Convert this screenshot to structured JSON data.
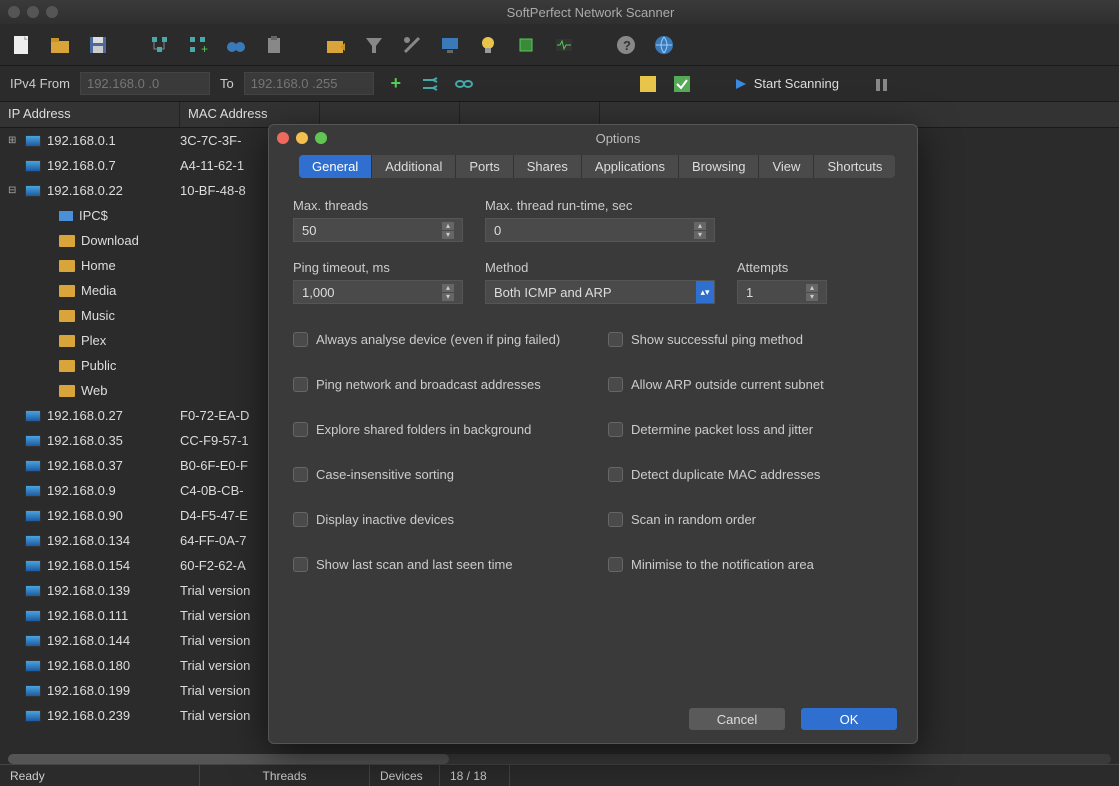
{
  "app_title": "SoftPerfect Network Scanner",
  "range": {
    "from_label": "IPv4 From",
    "from_placeholder": "192.168.0 .0",
    "to_label": "To",
    "to_placeholder": "192.168.0 .255"
  },
  "start_label": "Start Scanning",
  "columns": {
    "ip": "IP Address",
    "mac": "MAC Address",
    "rt": "",
    "hn": ""
  },
  "rows": [
    {
      "twisty": "+",
      "icon": "mon",
      "ip": "192.168.0.1",
      "mac": "3C-7C-3F-"
    },
    {
      "twisty": "",
      "icon": "mon",
      "ip": "192.168.0.7",
      "mac": "A4-11-62-1"
    },
    {
      "twisty": "-",
      "icon": "mon",
      "ip": "192.168.0.22",
      "mac": "10-BF-48-8"
    },
    {
      "twisty": "",
      "indent": 2,
      "icon": "share",
      "ip": "IPC$",
      "mac": ""
    },
    {
      "twisty": "",
      "indent": 2,
      "icon": "fold",
      "ip": "Download",
      "mac": ""
    },
    {
      "twisty": "",
      "indent": 2,
      "icon": "fold",
      "ip": "Home",
      "mac": ""
    },
    {
      "twisty": "",
      "indent": 2,
      "icon": "fold",
      "ip": "Media",
      "mac": ""
    },
    {
      "twisty": "",
      "indent": 2,
      "icon": "fold",
      "ip": "Music",
      "mac": ""
    },
    {
      "twisty": "",
      "indent": 2,
      "icon": "fold",
      "ip": "Plex",
      "mac": ""
    },
    {
      "twisty": "",
      "indent": 2,
      "icon": "fold",
      "ip": "Public",
      "mac": ""
    },
    {
      "twisty": "",
      "indent": 2,
      "icon": "fold",
      "ip": "Web",
      "mac": ""
    },
    {
      "twisty": "",
      "icon": "mon",
      "ip": "192.168.0.27",
      "mac": "F0-72-EA-D"
    },
    {
      "twisty": "",
      "icon": "mon",
      "ip": "192.168.0.35",
      "mac": "CC-F9-57-1"
    },
    {
      "twisty": "",
      "icon": "mon",
      "ip": "192.168.0.37",
      "mac": "B0-6F-E0-F"
    },
    {
      "twisty": "",
      "icon": "mon",
      "ip": "192.168.0.9",
      "mac": "C4-0B-CB-"
    },
    {
      "twisty": "",
      "icon": "mon",
      "ip": "192.168.0.90",
      "mac": "D4-F5-47-E"
    },
    {
      "twisty": "",
      "icon": "mon",
      "ip": "192.168.0.134",
      "mac": "64-FF-0A-7"
    },
    {
      "twisty": "",
      "icon": "mon",
      "ip": "192.168.0.154",
      "mac": "60-F2-62-A"
    },
    {
      "twisty": "",
      "icon": "mon",
      "ip": "192.168.0.139",
      "mac": "Trial version"
    },
    {
      "twisty": "",
      "icon": "mon",
      "ip": "192.168.0.111",
      "mac": "Trial version"
    },
    {
      "twisty": "",
      "icon": "mon",
      "ip": "192.168.0.144",
      "mac": "Trial version"
    },
    {
      "twisty": "",
      "icon": "mon",
      "ip": "192.168.0.180",
      "mac": "Trial version"
    },
    {
      "twisty": "",
      "icon": "mon",
      "ip": "192.168.0.199",
      "mac": "Trial version"
    },
    {
      "twisty": "",
      "icon": "mon",
      "ip": "192.168.0.239",
      "mac": "Trial version"
    }
  ],
  "status": {
    "ready": "Ready",
    "threads": "Threads",
    "devices": "Devices",
    "count": "18 / 18"
  },
  "dialog": {
    "title": "Options",
    "tabs": [
      "General",
      "Additional",
      "Ports",
      "Shares",
      "Applications",
      "Browsing",
      "View",
      "Shortcuts"
    ],
    "active_tab": 0,
    "fields": {
      "max_threads": {
        "label": "Max. threads",
        "value": "50"
      },
      "max_runtime": {
        "label": "Max. thread run-time, sec",
        "value": "0"
      },
      "ping_timeout": {
        "label": "Ping timeout, ms",
        "value": "1,000"
      },
      "method": {
        "label": "Method",
        "value": "Both ICMP and ARP"
      },
      "attempts": {
        "label": "Attempts",
        "value": "1"
      }
    },
    "checkboxes": [
      [
        "Always analyse device (even if ping failed)",
        "Show successful ping method"
      ],
      [
        "Ping network and broadcast addresses",
        "Allow ARP outside current subnet"
      ],
      [
        "Explore shared folders in background",
        "Determine packet loss and jitter"
      ],
      [
        "Case-insensitive sorting",
        "Detect duplicate MAC addresses"
      ],
      [
        "Display inactive devices",
        "Scan in random order"
      ],
      [
        "Show last scan and last seen time",
        "Minimise to the notification area"
      ]
    ],
    "cancel": "Cancel",
    "ok": "OK"
  }
}
